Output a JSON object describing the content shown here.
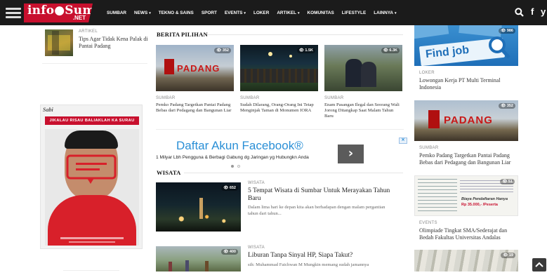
{
  "header": {
    "logo_main": "info●Sumbar",
    "logo_sub": ".NET",
    "nav": [
      {
        "label": "SUMBAR",
        "dropdown": false
      },
      {
        "label": "NEWS",
        "dropdown": true
      },
      {
        "label": "TEKNO & SAINS",
        "dropdown": false
      },
      {
        "label": "SPORT",
        "dropdown": false
      },
      {
        "label": "EVENTS",
        "dropdown": true
      },
      {
        "label": "LOKER",
        "dropdown": false
      },
      {
        "label": "ARTIKEL",
        "dropdown": true
      },
      {
        "label": "KOMUNITAS",
        "dropdown": false
      },
      {
        "label": "LIFESTYLE",
        "dropdown": false
      },
      {
        "label": "LAINNYA",
        "dropdown": true
      }
    ],
    "caret": "▾",
    "icons": [
      "search-icon",
      "facebook-icon",
      "twitter-icon"
    ],
    "fb_glyph": "f",
    "tw_glyph": "y"
  },
  "left": {
    "article": {
      "category": "ARTIKEL",
      "title": "Tips Agar Tidak Kena Palak di Pantai Padang"
    },
    "poster": {
      "brand": "Sabi",
      "headline": "JIKALAU RISAU BALIAKLAH KA SURAU"
    }
  },
  "berita_pilihan": {
    "heading": "BERITA PILIHAN",
    "items": [
      {
        "category": "SUMBAR",
        "title": "Pemko Padang Targetkan Pantai Padang Bebas dari Pedagang dan Bangunan Liar",
        "views": "352"
      },
      {
        "category": "SUMBAR",
        "title": "Sudah Dilarang, Orang-Orang Ini Tetap Menginjak Taman di Monumen IORA",
        "views": "1.5K"
      },
      {
        "category": "SUMBAR",
        "title": "Enam Pasangan Ilegal dan Seorang Wali Jorong Ditangkap Saat Malam Tahun Baru",
        "views": "6.3K"
      }
    ]
  },
  "ad": {
    "title": "Daftar Akun Facebook®",
    "subtitle": "1 Milyar Lbh Pengguna & Berbagi Gabung dg Jaringan yg Hubungkn Anda",
    "button": "›"
  },
  "wisata": {
    "heading": "WISATA",
    "items": [
      {
        "category": "WISATA",
        "title": "5 Tempat Wisata di Sumbar Untuk Merayakan Tahun Baru",
        "excerpt": "Dalam lima hari ke depan kita akan berhadapan dengan malam pergantian tahun dari tahun...",
        "views": "652"
      },
      {
        "category": "WISATA",
        "title": "Liburan Tanpa Sinyal HP, Siapa Takut?",
        "excerpt": "sih: Muhammad Faichwan M Mungkin memang sudah jamannya",
        "views": "400"
      }
    ]
  },
  "right": {
    "items": [
      {
        "category": "LOKER",
        "title": "Lowongan Kerja PT Multi Terminal Indonesia",
        "views": "986",
        "image_text": "Find job"
      },
      {
        "category": "SUMBAR",
        "title": "Pemko Padang Targetkan Pantai Padang Bebas dari Pedagang dan Bangunan Liar",
        "views": "352"
      },
      {
        "category": "EVENTS",
        "title": "Olimpiade Tingkat SMA/Sederajat dan Bedah Fakultas Universitas Andalas",
        "views": "51",
        "image_text": "Biaya Pendaftaran Hanya",
        "image_price": "Rp 35.000,- /Peserta"
      },
      {
        "views": "19"
      }
    ]
  },
  "colors": {
    "topbar": "#1b1b1b",
    "brand_red": "#c8102e",
    "accent_blue": "#2a8fd6"
  }
}
